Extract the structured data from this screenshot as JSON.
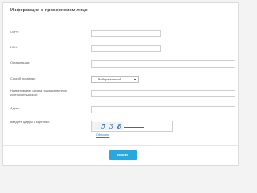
{
  "form": {
    "title": "Информация о проверяемом лице",
    "fields": {
      "ogrn": {
        "label": "ОГРН:",
        "value": ""
      },
      "inn": {
        "label": "ИНН:",
        "value": ""
      },
      "organization": {
        "label": "Организация:",
        "value": ""
      },
      "check_type": {
        "label": "Способ проверки:",
        "selected": "Выберите способ"
      },
      "authority": {
        "label": "Наименование органа государственного контроля(надзора):",
        "value": ""
      },
      "address": {
        "label": "Адрес:",
        "value": ""
      },
      "captcha": {
        "label": "Введите цифры с картинки:",
        "image_text": "5 3 8",
        "refresh_label": "Обновить"
      }
    },
    "submit_label": "Искать"
  }
}
